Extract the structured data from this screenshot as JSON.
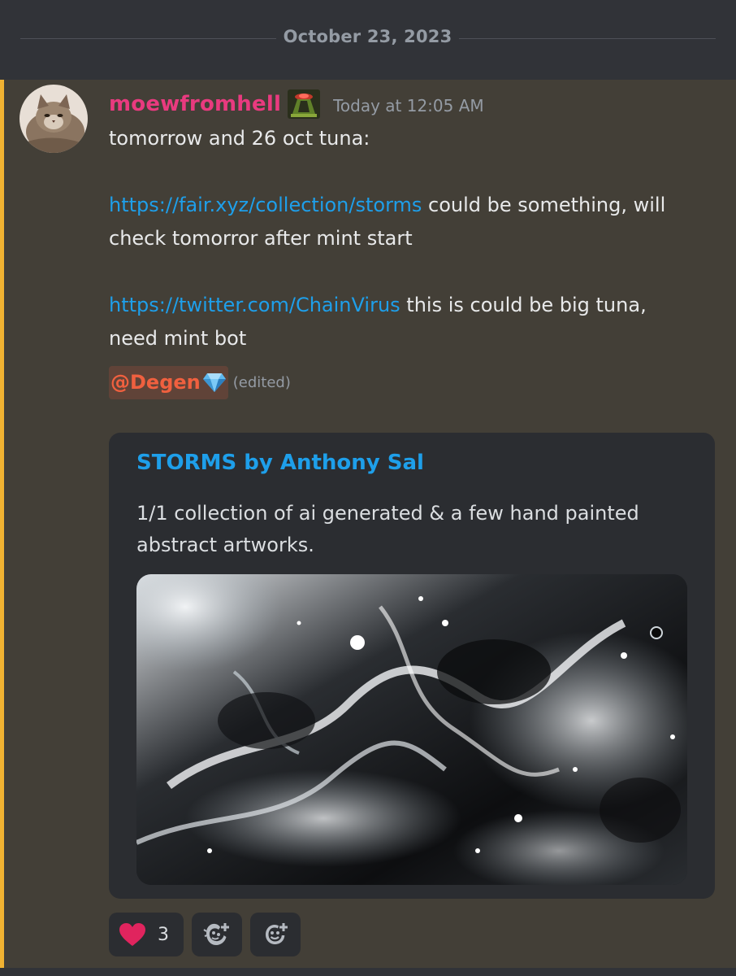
{
  "divider": {
    "date": "October 23, 2023"
  },
  "message": {
    "author": "moewfromhell",
    "timestamp": "Today at 12:05 AM",
    "avatar_icon": "cat-avatar",
    "role_icon": "ufo-icon",
    "lines": {
      "line1": "tomorrow and 26 oct tuna:",
      "link1": "https://fair.xyz/collection/storms",
      "line2_rest": " could be something, will",
      "line2_cont": "check tomorror after mint start",
      "link2": "https://twitter.com/ChainVirus",
      "line3_rest": " this is could be big tuna,",
      "line3_cont": "need mint bot"
    },
    "mention": "@Degen",
    "mention_icon": "gem-icon",
    "edited": "(edited)",
    "embed": {
      "title": "STORMS by Anthony Sal",
      "description": "1/1 collection of ai generated & a few hand painted abstract artworks.",
      "image": "abstract-storm-artwork"
    },
    "reactions": [
      {
        "icon": "heart-icon",
        "count": "3"
      },
      {
        "icon": "add-super-reaction-icon"
      },
      {
        "icon": "add-reaction-icon"
      }
    ]
  },
  "colors": {
    "username": "#e93a7f",
    "link": "#1e9fea",
    "highlight_bar": "#f0b232",
    "mention": "#f0603f",
    "message_bg": "#433f37",
    "embed_bg": "#2b2d31"
  }
}
